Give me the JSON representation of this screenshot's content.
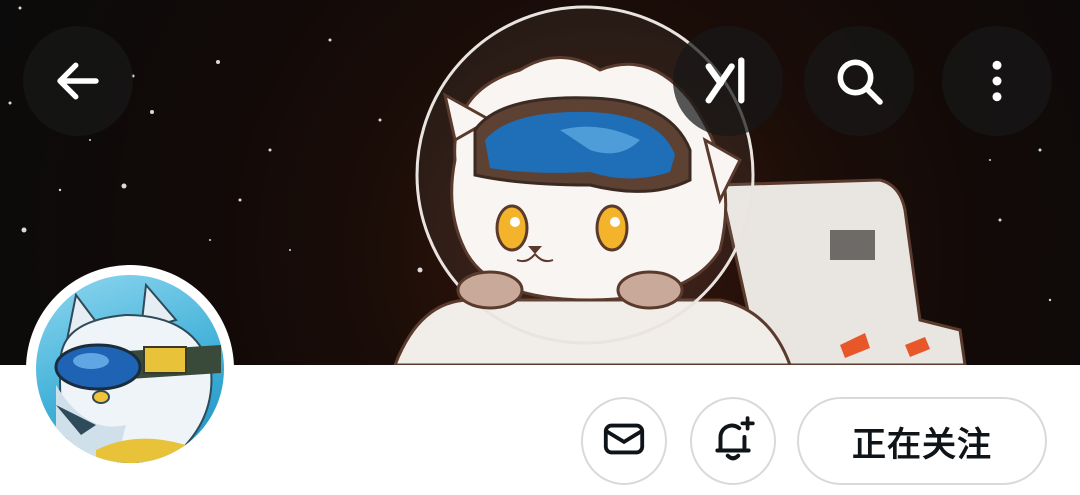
{
  "header": {
    "back_icon": "arrow-left-icon",
    "grok_icon": "grok-logo-icon",
    "search_icon": "search-icon",
    "more_icon": "more-vertical-icon"
  },
  "profile": {
    "banner": "astronaut-cat-illustration",
    "avatar": "wolf-with-goggles-illustration"
  },
  "actions": {
    "message_icon": "mail-icon",
    "notify_icon": "bell-plus-icon",
    "follow_label": "正在关注"
  },
  "colors": {
    "follow_text": "#0f1419",
    "button_border": "#d6dadd",
    "overlay_button": "#181818"
  }
}
